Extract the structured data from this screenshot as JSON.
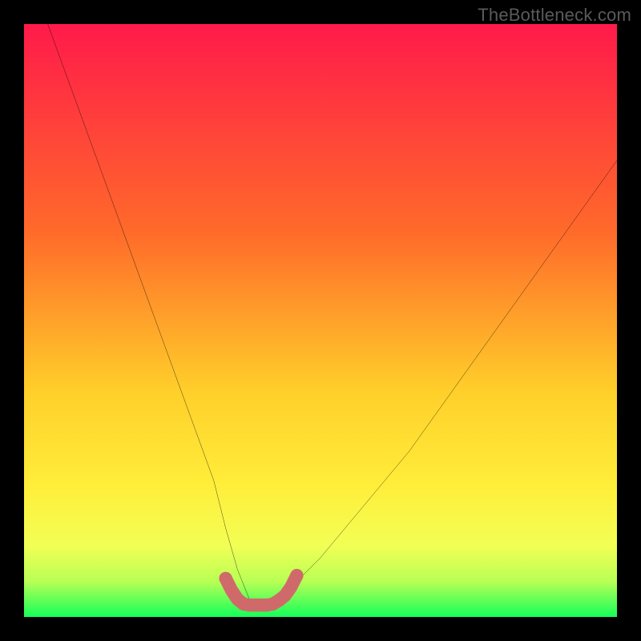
{
  "watermark": "TheBottleneck.com",
  "colors": {
    "frame": "#000000",
    "gradient_top": "#ff1a4a",
    "gradient_mid1": "#ff8a2a",
    "gradient_mid2": "#ffe23a",
    "gradient_mid3": "#f7ff5a",
    "gradient_bottom": "#15ff5a",
    "curve": "#000000",
    "marker": "#d06a6a"
  },
  "chart_data": {
    "type": "line",
    "title": "",
    "xlabel": "",
    "ylabel": "",
    "xlim": [
      0,
      100
    ],
    "ylim": [
      0,
      100
    ],
    "series": [
      {
        "name": "bottleneck-curve",
        "x": [
          4,
          8,
          12,
          16,
          20,
          24,
          28,
          32,
          34,
          36,
          38,
          40,
          42,
          44,
          46,
          50,
          55,
          60,
          65,
          70,
          75,
          80,
          85,
          90,
          95,
          100
        ],
        "y": [
          100,
          89,
          78,
          67,
          56,
          45,
          34,
          23,
          15,
          8,
          3,
          2,
          2,
          3,
          6,
          10,
          16,
          22,
          28,
          35,
          42,
          49,
          56,
          63,
          70,
          77
        ]
      },
      {
        "name": "optimal-range-marker",
        "x": [
          34,
          35,
          36,
          37,
          38,
          39,
          40,
          41,
          42,
          43,
          44,
          45,
          46
        ],
        "y": [
          6.5,
          4.5,
          3,
          2.2,
          2,
          2,
          2,
          2,
          2.2,
          2.8,
          3.6,
          5,
          7
        ]
      }
    ],
    "gradient_bands_pct": [
      0,
      62,
      78,
      88,
      94,
      100
    ]
  }
}
